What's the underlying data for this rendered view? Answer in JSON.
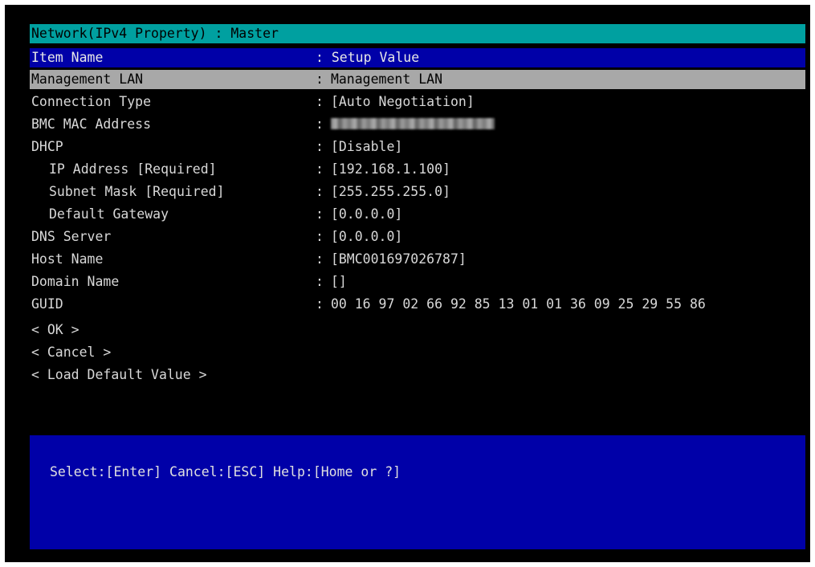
{
  "window": {
    "title": "Network(IPv4 Property) : Master"
  },
  "header": {
    "name": "Item Name",
    "value": ": Setup Value"
  },
  "items": [
    {
      "label": "Management LAN",
      "value": "Management LAN"
    },
    {
      "label": "Connection Type",
      "value": "[Auto Negotiation]"
    },
    {
      "label": "BMC MAC Address",
      "value": ""
    },
    {
      "label": "DHCP",
      "value": "[Disable]"
    },
    {
      "label": "IP Address [Required]",
      "value": "[192.168.1.100]"
    },
    {
      "label": "Subnet Mask [Required]",
      "value": "[255.255.255.0]"
    },
    {
      "label": "Default Gateway",
      "value": "[0.0.0.0]"
    },
    {
      "label": "DNS Server",
      "value": "[0.0.0.0]"
    },
    {
      "label": "Host Name",
      "value": "[BMC001697026787]"
    },
    {
      "label": "Domain Name",
      "value": "[]"
    },
    {
      "label": "GUID",
      "value": "00 16 97 02 66 92 85 13 01 01 36 09 25 29 55 86"
    }
  ],
  "separator": ":",
  "actions": {
    "ok": "< OK >",
    "cancel": "< Cancel >",
    "load_default": "< Load Default Value >"
  },
  "help": {
    "text": "Select:[Enter] Cancel:[ESC] Help:[Home or ?]"
  },
  "colors": {
    "background": "#000000",
    "title_bar": "#00a0a0",
    "header_bar": "#0000a8",
    "selected_row": "#a8a8a8",
    "help_panel": "#0000a8",
    "text": "#d8d8d8"
  }
}
